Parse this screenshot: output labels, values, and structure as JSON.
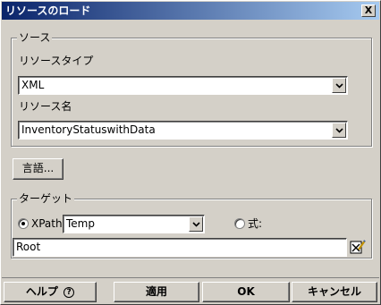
{
  "window": {
    "title": "リソースのロード",
    "close_label": "X"
  },
  "source_group": {
    "legend": "ソース",
    "resource_type_label": "リソースタイプ",
    "resource_type_value": "XML",
    "resource_name_label": "リソース名",
    "resource_name_value": "InventoryStatuswithData"
  },
  "language_button": "言語...",
  "target_group": {
    "legend": "ターゲット",
    "xpath_label": "XPath:",
    "xpath_value": "Temp",
    "expression_label": "式:",
    "expression_text": "Root"
  },
  "footer": {
    "help_label": "ヘルプ",
    "help_icon": "?",
    "apply_label": "適用",
    "ok_label": "OK",
    "cancel_label": "キャンセル"
  }
}
